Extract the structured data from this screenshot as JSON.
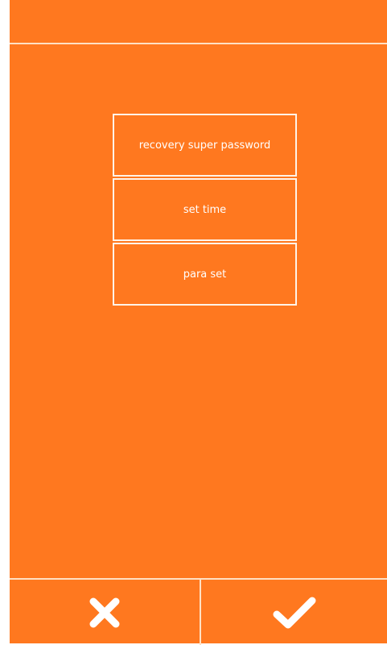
{
  "colors": {
    "background": "#ff781f",
    "line": "#ffe0c4",
    "text": "#ffffff"
  },
  "menu": {
    "items": [
      {
        "label": "recovery super password"
      },
      {
        "label": "set time"
      },
      {
        "label": "para set"
      }
    ]
  },
  "footer": {
    "cancel_icon": "close-icon",
    "confirm_icon": "check-icon"
  }
}
